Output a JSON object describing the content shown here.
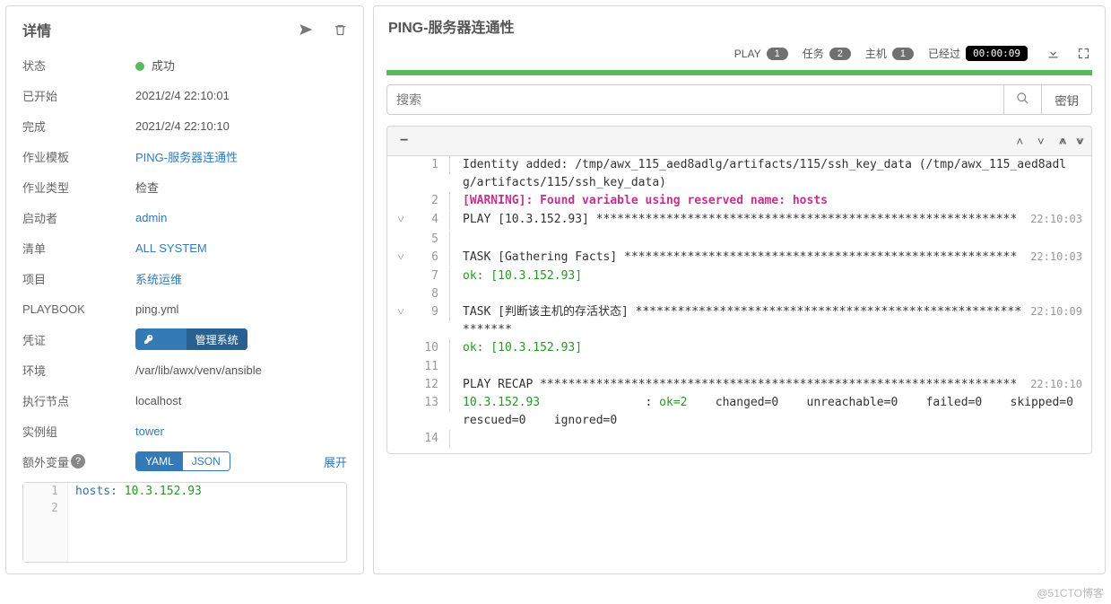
{
  "details": {
    "title": "详情",
    "rows": {
      "status_label": "状态",
      "status_value": "成功",
      "started_label": "已开始",
      "started_value": "2021/2/4 22:10:01",
      "finished_label": "完成",
      "finished_value": "2021/2/4 22:10:10",
      "template_label": "作业模板",
      "template_value": "PING-服务器连通性",
      "type_label": "作业类型",
      "type_value": "检查",
      "launched_label": "启动者",
      "launched_value": "admin",
      "inventory_label": "清单",
      "inventory_value": "ALL SYSTEM",
      "project_label": "项目",
      "project_value": "系统运维",
      "playbook_label": "PLAYBOOK",
      "playbook_value": "ping.yml",
      "cred_label": "凭证",
      "cred_suffix": "管理系统",
      "env_label": "环境",
      "env_value": "/var/lib/awx/venv/ansible",
      "node_label": "执行节点",
      "node_value": "localhost",
      "group_label": "实例组",
      "group_value": "tower",
      "extra_label": "额外变量",
      "expand": "展开",
      "yaml_btn": "YAML",
      "json_btn": "JSON"
    },
    "code": {
      "l1_key": "hosts:",
      "l1_val": " 10.3.152.93"
    }
  },
  "right": {
    "title": "PING-服务器连通性",
    "stats": {
      "play_label": "PLAY",
      "play_count": "1",
      "tasks_label": "任务",
      "tasks_count": "2",
      "hosts_label": "主机",
      "hosts_count": "1",
      "elapsed_label": "已经过",
      "elapsed_value": "00:00:09"
    },
    "search_placeholder": "搜索",
    "key_btn": "密钥",
    "collapse": "−",
    "lines": [
      {
        "num": "1",
        "caret": "",
        "text": "Identity added: /tmp/awx_115_aed8adlg/artifacts/115/ssh_key_data (/tmp/awx_115_aed8adlg/artifacts/115/ssh_key_data)",
        "time": ""
      },
      {
        "num": "2",
        "caret": "",
        "cls": "warn",
        "text": "[WARNING]: Found variable using reserved name: hosts",
        "time": ""
      },
      {
        "num": "",
        "caret": "",
        "text": "",
        "time": ""
      },
      {
        "num": "4",
        "caret": "˅",
        "text": "PLAY [10.3.152.93] ************************************************************",
        "time": "22:10:03"
      },
      {
        "num": "5",
        "caret": "",
        "text": "",
        "time": ""
      },
      {
        "num": "6",
        "caret": "˅",
        "text": "TASK [Gathering Facts] ********************************************************",
        "time": "22:10:03"
      },
      {
        "num": "7",
        "caret": "",
        "cls": "ok",
        "text": "ok: [10.3.152.93]",
        "time": ""
      },
      {
        "num": "8",
        "caret": "",
        "text": "",
        "time": ""
      },
      {
        "num": "9",
        "caret": "˅",
        "text": "TASK [判断该主机的存活状态] **************************************************************",
        "time": "22:10:09"
      },
      {
        "num": "10",
        "caret": "",
        "cls": "ok",
        "text": "ok: [10.3.152.93]",
        "time": ""
      },
      {
        "num": "11",
        "caret": "",
        "text": "",
        "time": ""
      },
      {
        "num": "12",
        "caret": "",
        "text": "PLAY RECAP ********************************************************************",
        "time": "22:10:10"
      },
      {
        "num": "13",
        "caret": "",
        "recap": true,
        "host": "10.3.152.93",
        "ok": "ok=2",
        "rest": "    changed=0    unreachable=0    failed=0    skipped=0    rescued=0    ignored=0",
        "time": ""
      },
      {
        "num": "14",
        "caret": "",
        "text": "",
        "time": ""
      }
    ]
  },
  "watermark": "@51CTO博客"
}
